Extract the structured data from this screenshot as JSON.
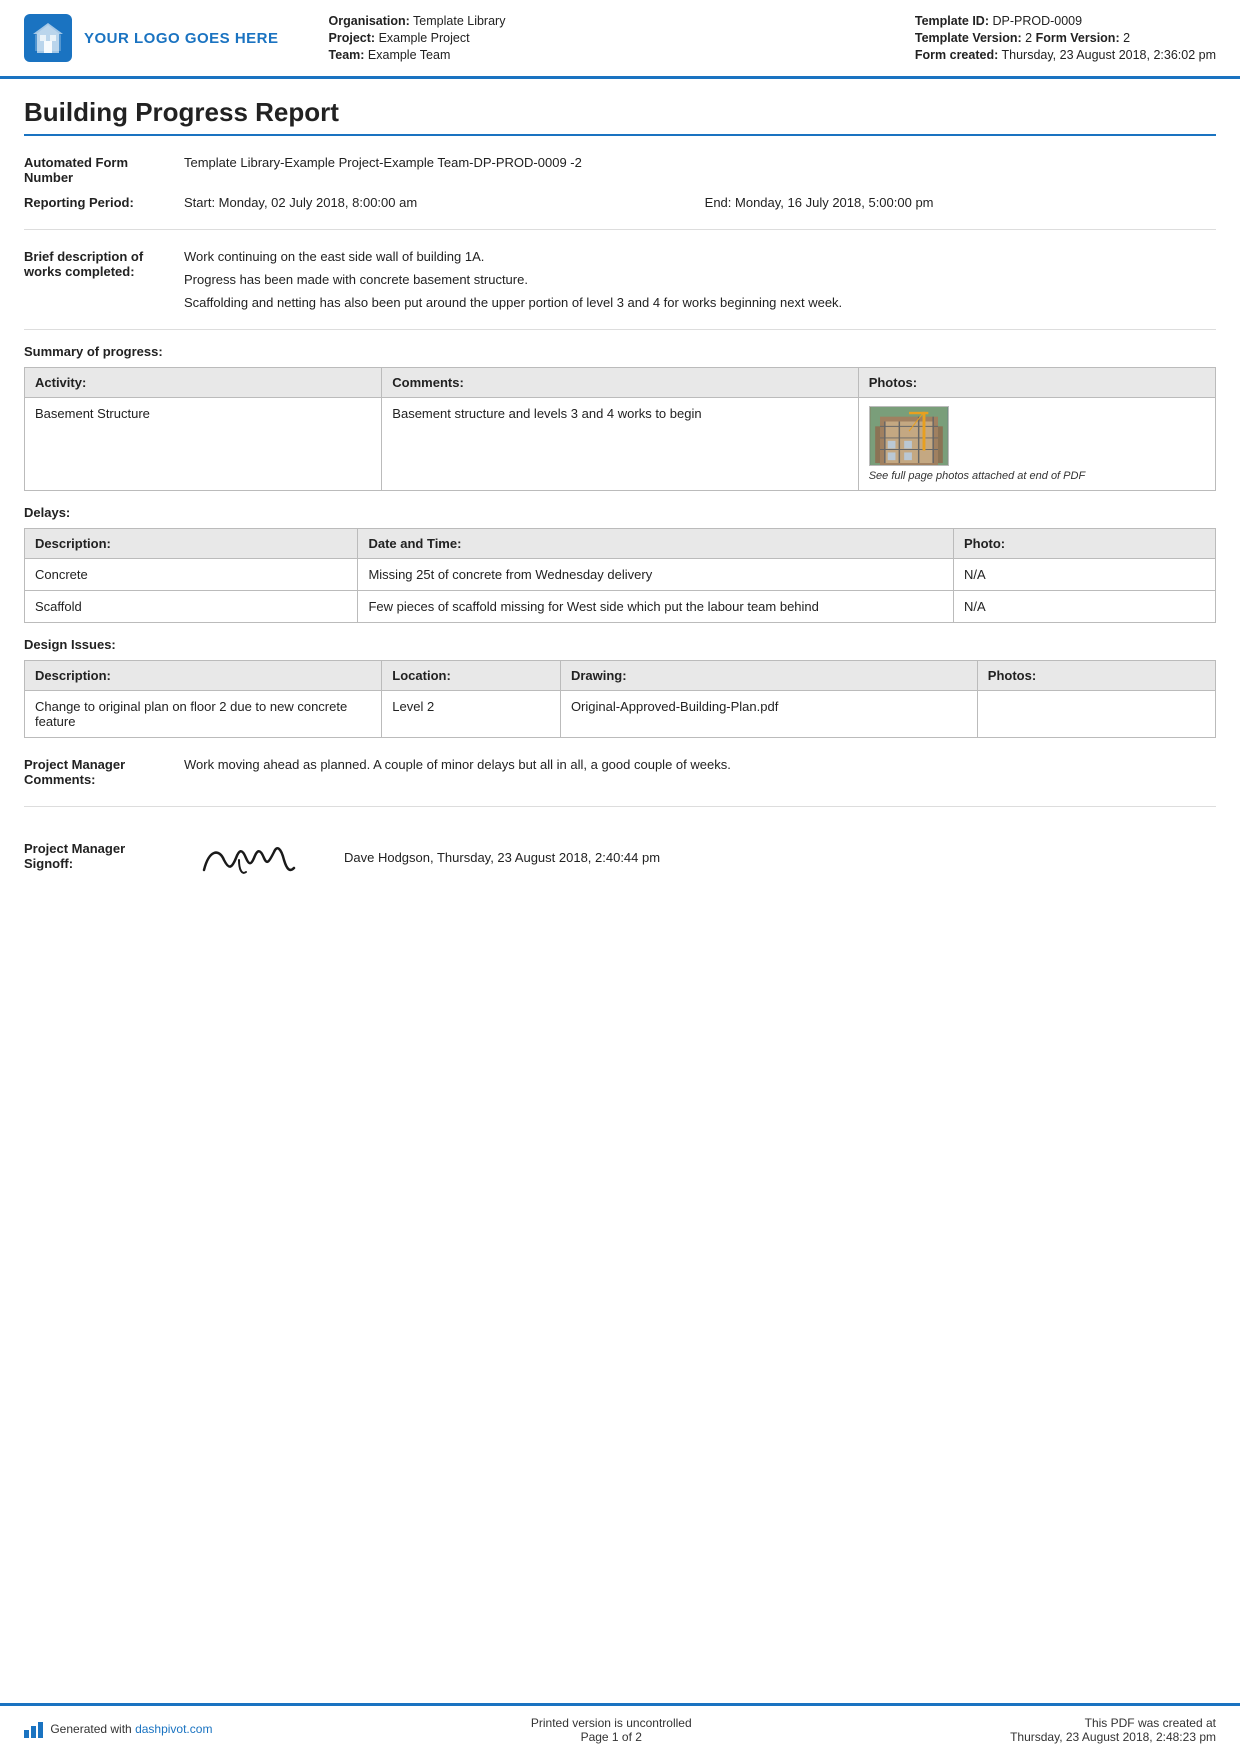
{
  "header": {
    "logo_text": "YOUR LOGO GOES HERE",
    "org_label": "Organisation:",
    "org_value": "Template Library",
    "project_label": "Project:",
    "project_value": "Example Project",
    "team_label": "Team:",
    "team_value": "Example Team",
    "template_id_label": "Template ID:",
    "template_id_value": "DP-PROD-0009",
    "template_version_label": "Template Version:",
    "template_version_value": "2",
    "form_version_label": "Form Version:",
    "form_version_value": "2",
    "form_created_label": "Form created:",
    "form_created_value": "Thursday, 23 August 2018, 2:36:02 pm"
  },
  "report": {
    "title": "Building Progress Report",
    "automated_form_number_label": "Automated Form Number",
    "automated_form_number_value": "Template Library-Example Project-Example Team-DP-PROD-0009   -2",
    "reporting_period_label": "Reporting Period:",
    "reporting_period_start": "Start: Monday, 02 July 2018, 8:00:00 am",
    "reporting_period_end": "End: Monday, 16 July 2018, 5:00:00 pm",
    "brief_description_label": "Brief description of works completed:",
    "brief_description_lines": [
      "Work continuing on the east side wall of building 1A.",
      "Progress has been made with concrete basement structure.",
      "Scaffolding and netting has also been put around the upper portion of level 3 and 4 for works beginning next week."
    ],
    "summary_section_header": "Summary of progress:",
    "summary_columns": [
      "Activity:",
      "Comments:",
      "Photos:"
    ],
    "summary_rows": [
      {
        "activity": "Basement Structure",
        "comments": "Basement structure and levels 3 and 4 works to begin",
        "photo_caption": "See full page photos attached at end of PDF"
      }
    ],
    "delays_header": "Delays:",
    "delays_columns": [
      "Description:",
      "Date and Time:",
      "Photo:"
    ],
    "delays_rows": [
      {
        "description": "Concrete",
        "date_time": "Missing 25t of concrete from Wednesday delivery",
        "photo": "N/A"
      },
      {
        "description": "Scaffold",
        "date_time": "Few pieces of scaffold missing for West side which put the labour team behind",
        "photo": "N/A"
      }
    ],
    "design_issues_header": "Design Issues:",
    "design_issues_columns": [
      "Description:",
      "Location:",
      "Drawing:",
      "Photos:"
    ],
    "design_issues_rows": [
      {
        "description": "Change to original plan on floor 2 due to new concrete feature",
        "location": "Level 2",
        "drawing": "Original-Approved-Building-Plan.pdf",
        "photos": ""
      }
    ],
    "pm_comments_label": "Project Manager Comments:",
    "pm_comments_value": "Work moving ahead as planned. A couple of minor delays but all in all, a good couple of weeks.",
    "pm_signoff_label": "Project Manager Signoff:",
    "pm_signoff_text": "Dave Hodgson, Thursday, 23 August 2018, 2:40:44 pm"
  },
  "footer": {
    "generated_text": "Generated with ",
    "generated_link": "dashpivot.com",
    "printed_label": "Printed version is uncontrolled",
    "page_label": "Page 1 of 2",
    "pdf_created_label": "This PDF was created at",
    "pdf_created_value": "Thursday, 23 August 2018, 2:48:23 pm"
  }
}
